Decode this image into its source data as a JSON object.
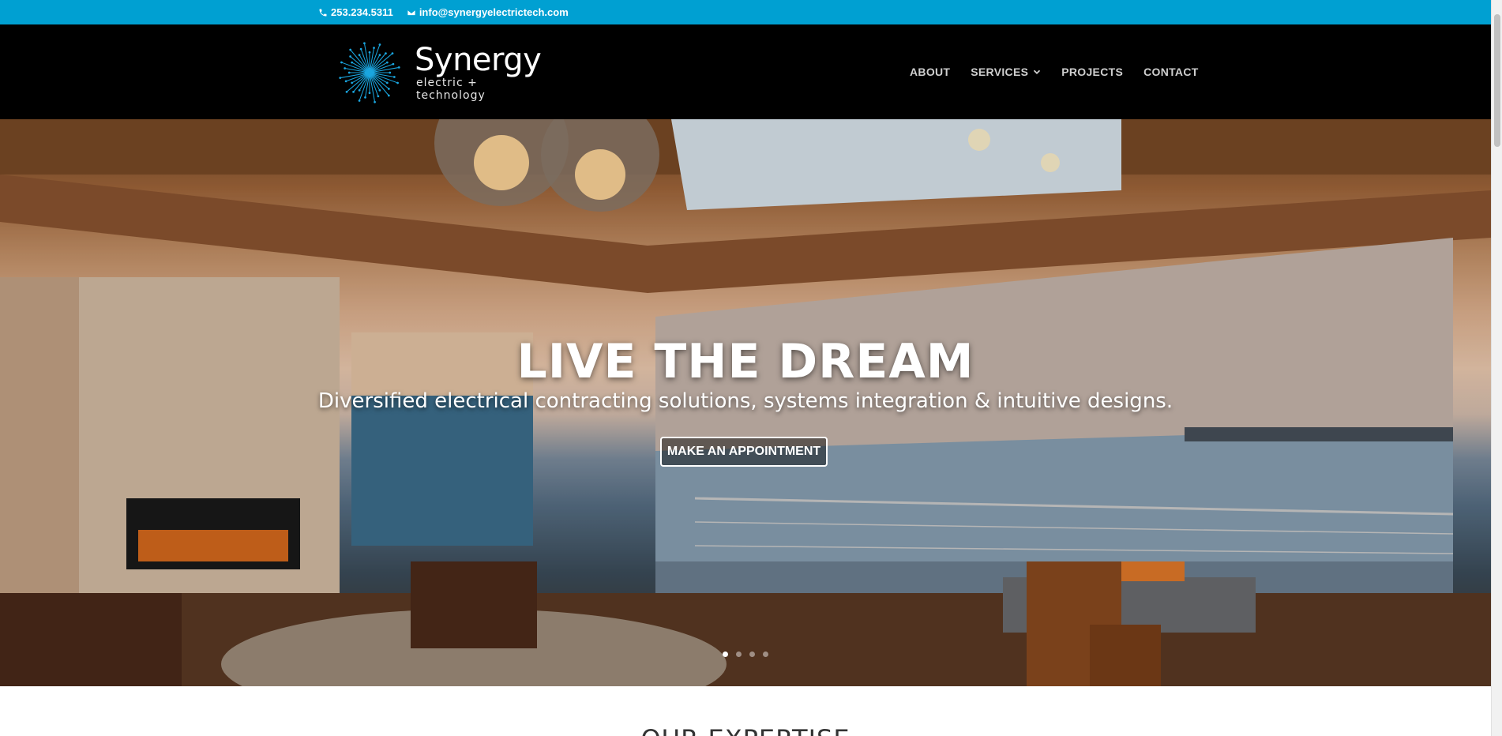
{
  "topbar": {
    "phone": "253.234.5311",
    "email": "info@synergyelectrictech.com"
  },
  "header": {
    "logo": {
      "brand": "Synergy",
      "tagline": "electric + technology"
    },
    "nav": [
      {
        "label": "ABOUT"
      },
      {
        "label": "SERVICES",
        "has_dropdown": true
      },
      {
        "label": "PROJECTS"
      },
      {
        "label": "CONTACT"
      }
    ]
  },
  "hero": {
    "title": "LIVE THE DREAM",
    "subtitle": "Diversified electrical contracting solutions, systems integration & intuitive designs.",
    "cta_label": "MAKE AN APPOINTMENT",
    "slides": {
      "count": 4,
      "active": 1
    }
  },
  "expertise": {
    "heading": "OUR EXPERTISE"
  },
  "colors": {
    "topbar": "#00a0d2",
    "header": "#000000",
    "accent": "#1aa6e0"
  }
}
